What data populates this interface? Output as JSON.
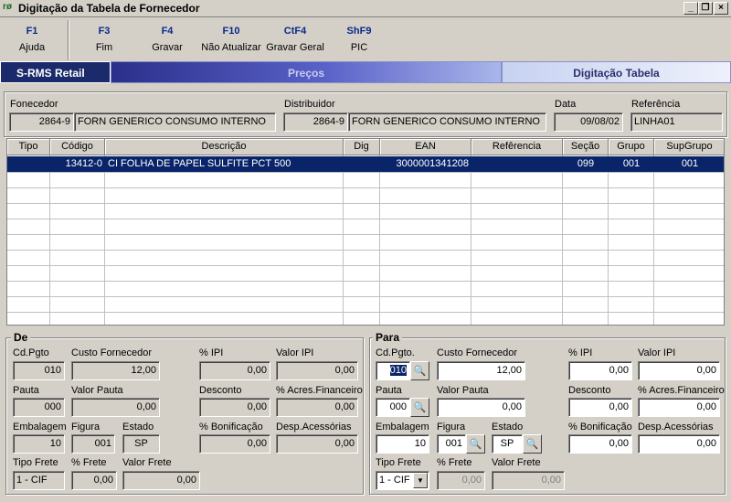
{
  "window": {
    "title": "Digitação da Tabela de Fornecedor",
    "icon_glyph": "rø",
    "minimize": "_",
    "restore": "❐",
    "close": "×"
  },
  "toolbar": [
    {
      "key": "F1",
      "label": "Ajuda"
    },
    {
      "key": "F3",
      "label": "Fim"
    },
    {
      "key": "F4",
      "label": "Gravar"
    },
    {
      "key": "F10",
      "label": "Não Atualizar"
    },
    {
      "key": "CtF4",
      "label": "Gravar Geral"
    },
    {
      "key": "ShF9",
      "label": "PIC"
    }
  ],
  "banner": {
    "left": "S-RMS Retail",
    "middle": "Preços",
    "right": "Digitação Tabela"
  },
  "header": {
    "fornecedor_label": "Fonecedor",
    "fornecedor_code": "2864-9",
    "fornecedor_name": "FORN GENERICO CONSUMO INTERNO",
    "distribuidor_label": "Distribuidor",
    "distribuidor_code": "2864-9",
    "distribuidor_name": "FORN GENERICO CONSUMO INTERNO",
    "data_label": "Data",
    "data_value": "09/08/02",
    "referencia_label": "Referência",
    "referencia_value": "LINHA01"
  },
  "grid": {
    "columns": [
      "Tipo",
      "Código",
      "Descrição",
      "Dig",
      "EAN",
      "Refêrencia",
      "Seção",
      "Grupo",
      "SupGrupo"
    ],
    "rows": [
      {
        "tipo": "",
        "codigo": "13412-0",
        "descricao": "CI FOLHA DE PAPEL SULFITE PCT 500",
        "dig": "",
        "ean": "3000001341208",
        "referencia": "",
        "secao": "099",
        "grupo": "001",
        "supgrupo": "001"
      }
    ]
  },
  "de": {
    "legend": "De",
    "cd_pgto_label": "Cd.Pgto",
    "cd_pgto": "010",
    "custo_label": "Custo Fornecedor",
    "custo": "12,00",
    "ipi_label": "% IPI",
    "ipi": "0,00",
    "valor_ipi_label": "Valor IPI",
    "valor_ipi": "0,00",
    "pauta_label": "Pauta",
    "pauta": "000",
    "valor_pauta_label": "Valor Pauta",
    "valor_pauta": "0,00",
    "desconto_label": "Desconto",
    "desconto": "0,00",
    "acres_label": "% Acres.Financeiro",
    "acres": "0,00",
    "embalagem_label": "Embalagem",
    "embalagem": "10",
    "figura_label": "Figura",
    "figura": "001",
    "estado_label": "Estado",
    "estado": "SP",
    "bonif_label": "% Bonificação",
    "bonif": "0,00",
    "desp_label": "Desp.Acessórias",
    "desp": "0,00",
    "tipo_frete_label": "Tipo Frete",
    "tipo_frete": "1 - CIF",
    "pct_frete_label": "% Frete",
    "pct_frete": "0,00",
    "valor_frete_label": "Valor Frete",
    "valor_frete": "0,00"
  },
  "para": {
    "legend": "Para",
    "cd_pgto_label": "Cd.Pgto.",
    "cd_pgto": "010",
    "custo_label": "Custo Fornecedor",
    "custo": "12,00",
    "ipi_label": "% IPI",
    "ipi": "0,00",
    "valor_ipi_label": "Valor IPI",
    "valor_ipi": "0,00",
    "pauta_label": "Pauta",
    "pauta": "000",
    "valor_pauta_label": "Valor Pauta",
    "valor_pauta": "0,00",
    "desconto_label": "Desconto",
    "desconto": "0,00",
    "acres_label": "% Acres.Financeiro",
    "acres": "0,00",
    "embalagem_label": "Embalagem",
    "embalagem": "10",
    "figura_label": "Figura",
    "figura": "001",
    "estado_label": "Estado",
    "estado": "SP",
    "bonif_label": "% Bonificação",
    "bonif": "0,00",
    "desp_label": "Desp.Acessórias",
    "desp": "0,00",
    "tipo_frete_label": "Tipo Frete",
    "tipo_frete": "1 - CIF",
    "pct_frete_label": "% Frete",
    "pct_frete": "0,00",
    "valor_frete_label": "Valor Frete",
    "valor_frete": "0,00",
    "binoculars_glyph": "🔍"
  },
  "colors": {
    "window_bg": "#d4d0c8",
    "selection": "#0a246a",
    "banner_dark": "#1b2a6b",
    "fkey_blue": "#0a2a8a"
  }
}
